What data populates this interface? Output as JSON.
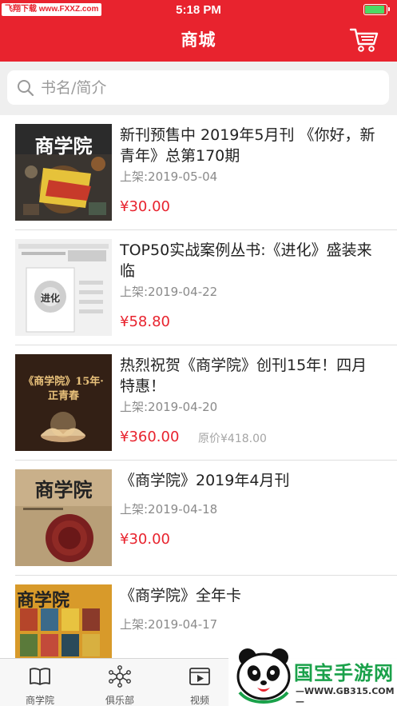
{
  "status_bar": {
    "watermark": "飞翔下载 www.FXXZ.com",
    "time": "5:18 PM",
    "battery_level": 0.95
  },
  "header": {
    "title": "商城",
    "cart_icon": "shopping-cart-icon"
  },
  "search": {
    "placeholder": "书名/简介",
    "value": ""
  },
  "products": [
    {
      "title": "新刊预售中 2019年5月刊 《你好，新青年》总第170期",
      "date": "上架:2019-05-04",
      "price": "¥30.00",
      "original_price": "",
      "cover_text": "商学院"
    },
    {
      "title": "TOP50实战案例丛书:《进化》盛装来临",
      "date": "上架:2019-04-22",
      "price": "¥58.80",
      "original_price": "",
      "cover_text": "进化"
    },
    {
      "title": "热烈祝贺《商学院》创刊15年！四月特惠！",
      "date": "上架:2019-04-20",
      "price": "¥360.00",
      "original_price": "原价¥418.00",
      "cover_text": "《商学院》15年·正青春"
    },
    {
      "title": "《商学院》2019年4月刊",
      "date": "上架:2019-04-18",
      "price": "¥30.00",
      "original_price": "",
      "cover_text": "商学院"
    },
    {
      "title": "《商学院》全年卡",
      "date": "上架:2019-04-17",
      "price": "",
      "original_price": "",
      "cover_text": "商学院"
    }
  ],
  "tabs": [
    {
      "label": "商学院",
      "icon": "book-icon"
    },
    {
      "label": "俱乐部",
      "icon": "network-icon"
    },
    {
      "label": "视频",
      "icon": "video-icon"
    }
  ],
  "corner_logo": {
    "brand": "国宝手游网",
    "url": "—WWW.GB315.COM—"
  },
  "colors": {
    "accent": "#e8232e",
    "price": "#e8232e",
    "muted": "#8a8a8a"
  }
}
